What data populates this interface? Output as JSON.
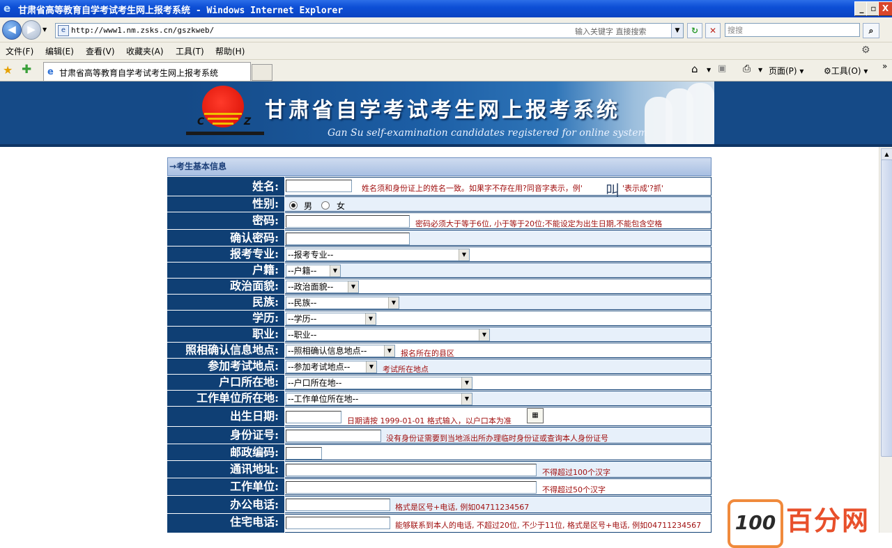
{
  "window": {
    "title": "甘肃省高等教育自学考试考生网上报考系统 - Windows Internet Explorer",
    "min": "_",
    "max": "▫",
    "close": "X"
  },
  "address": {
    "url": "http://www1.nm.zsks.cn/gszkweb/",
    "hint": "输入关键字 直接搜索",
    "search_placeholder": "搜搜"
  },
  "menu": [
    "文件(F)",
    "编辑(E)",
    "查看(V)",
    "收藏夹(A)",
    "工具(T)",
    "帮助(H)"
  ],
  "tab": {
    "label": "甘肃省高等教育自学考试考生网上报考系统"
  },
  "toolbar": {
    "page": "页面(P)",
    "tools": "工具(O)"
  },
  "banner": {
    "title": "甘肃省自学考试考生网上报考系统",
    "subtitle": "Gan Su self-examination candidates registered for online system",
    "logo_c": "C",
    "logo_z": "Z"
  },
  "form": {
    "header": "→考生基本信息",
    "fields": {
      "name": {
        "label": "姓名:",
        "note_a": "姓名须和身份证上的姓名一致。如果字不存在用?同音字表示，例'",
        "sample": "叫",
        "note_b": "'表示成'?抓'"
      },
      "gender": {
        "label": "性别:",
        "male": "男",
        "female": "女"
      },
      "password": {
        "label": "密码:",
        "note": "密码必须大于等于6位, 小于等于20位;不能设定为出生日期,不能包含空格"
      },
      "confirm": {
        "label": "确认密码:"
      },
      "major": {
        "label": "报考专业:",
        "value": "--报考专业--"
      },
      "huji": {
        "label": "户籍:",
        "value": "--户籍--"
      },
      "political": {
        "label": "政治面貌:",
        "value": "--政治面貌--"
      },
      "ethnic": {
        "label": "民族:",
        "value": "--民族--"
      },
      "education": {
        "label": "学历:",
        "value": "--学历--"
      },
      "job": {
        "label": "职业:",
        "value": "--职业--"
      },
      "photo": {
        "label": "照相确认信息地点:",
        "value": "--照相确认信息地点--",
        "note": "报名所在的县区"
      },
      "exam": {
        "label": "参加考试地点:",
        "value": "--参加考试地点--",
        "note": "考试所在地点"
      },
      "hukou": {
        "label": "户口所在地:",
        "value": "--户口所在地--"
      },
      "work_loc": {
        "label": "工作单位所在地:",
        "value": "--工作单位所在地--"
      },
      "birth": {
        "label": "出生日期:",
        "note": "日期请按 1999-01-01 格式输入，以户口本为准"
      },
      "idcard": {
        "label": "身份证号:",
        "note": "没有身份证需要到当地派出所办理临时身份证或查询本人身份证号"
      },
      "postcode": {
        "label": "邮政编码:"
      },
      "address": {
        "label": "通讯地址:",
        "note": "不得超过100个汉字"
      },
      "company": {
        "label": "工作单位:",
        "note": "不得超过50个汉字"
      },
      "office_phone": {
        "label": "办公电话:",
        "note": "格式是区号+电话, 例如04711234567"
      },
      "home_phone": {
        "label": "住宅电话:",
        "note": "能够联系到本人的电话, 不超过20位, 不少于11位, 格式是区号+电话, 例如04711234567"
      }
    }
  },
  "watermark": {
    "num": "100",
    "text": "百分网"
  }
}
